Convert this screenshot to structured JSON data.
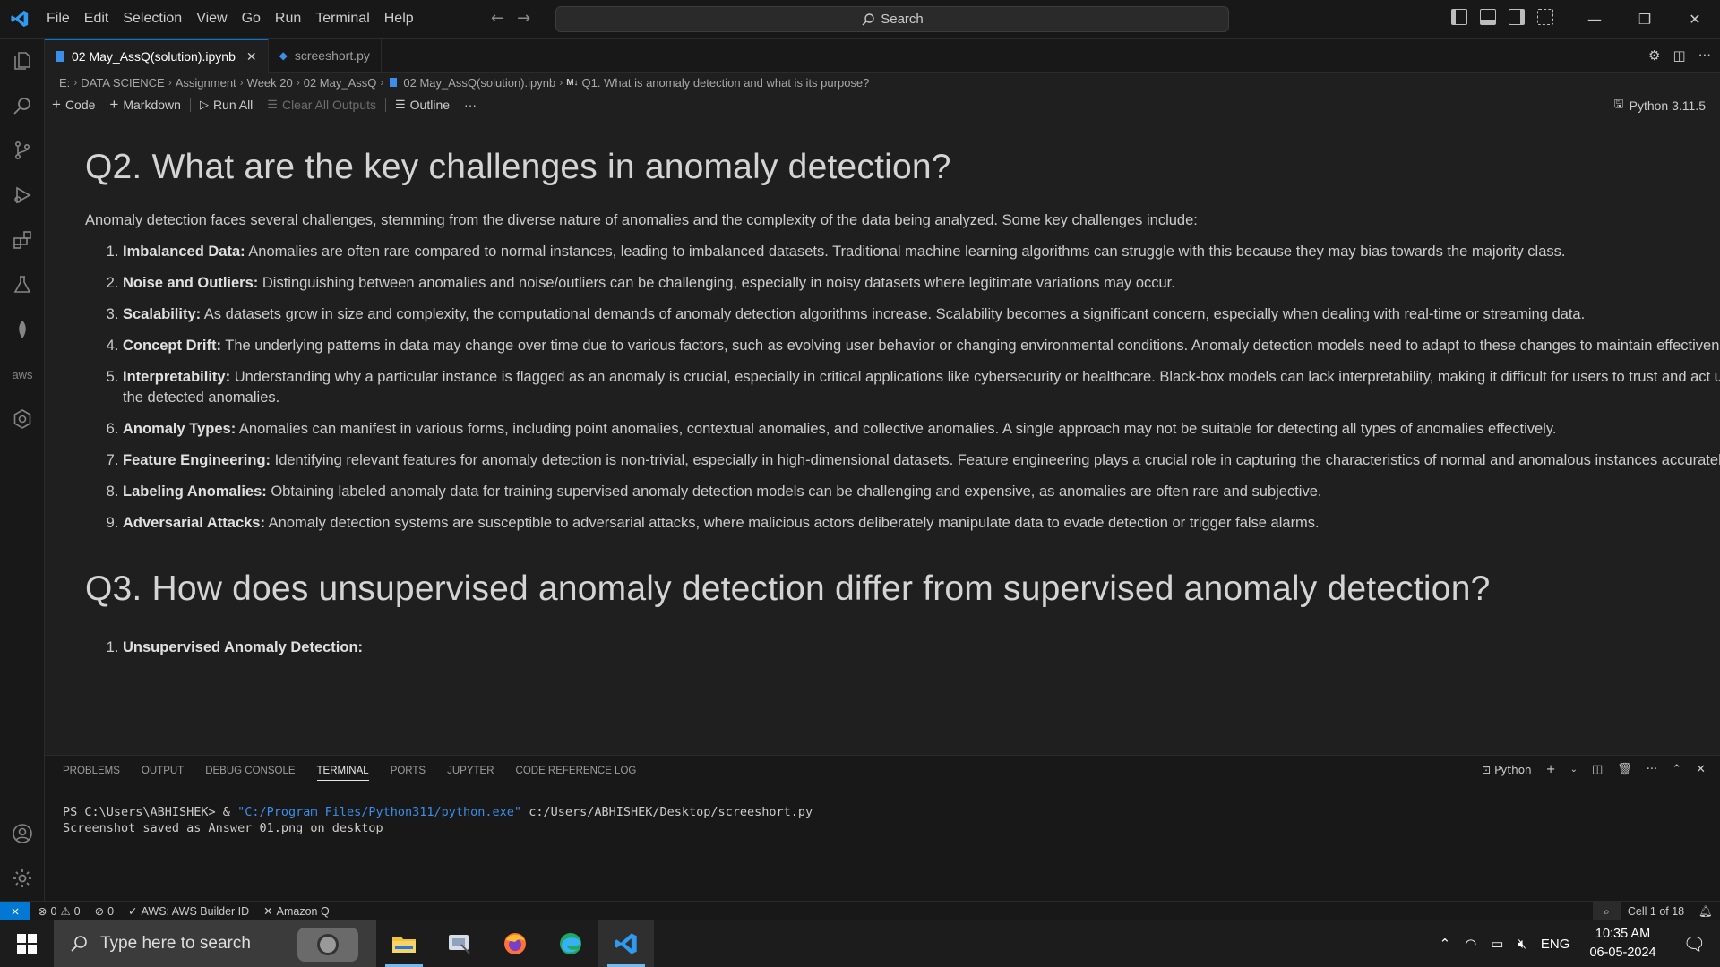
{
  "menu": [
    "File",
    "Edit",
    "Selection",
    "View",
    "Go",
    "Run",
    "Terminal",
    "Help"
  ],
  "search": {
    "label": "Search"
  },
  "tabs": [
    {
      "label": "02 May_AssQ(solution).ipynb",
      "active": true
    },
    {
      "label": "screeshort.py",
      "active": false
    }
  ],
  "breadcrumb": [
    "E:",
    "DATA SCIENCE",
    "Assignment",
    "Week 20",
    "02 May_AssQ",
    "02 May_AssQ(solution).ipynb",
    "Q1. What is anomaly detection and what is its purpose?"
  ],
  "breadcrumb_md_badge": "M↓",
  "notebook_toolbar": {
    "code": "Code",
    "markdown": "Markdown",
    "run_all": "Run All",
    "clear_outputs": "Clear All Outputs",
    "outline": "Outline",
    "more": "···",
    "kernel": "Python 3.11.5"
  },
  "notebook": {
    "q2_heading": "Q2. What are the key challenges in anomaly detection?",
    "q2_intro": "Anomaly detection faces several challenges, stemming from the diverse nature of anomalies and the complexity of the data being analyzed. Some key challenges include:",
    "challenges": [
      {
        "term": "Imbalanced Data:",
        "text": " Anomalies are often rare compared to normal instances, leading to imbalanced datasets. Traditional machine learning algorithms can struggle with this because they may bias towards the majority class."
      },
      {
        "term": "Noise and Outliers:",
        "text": " Distinguishing between anomalies and noise/outliers can be challenging, especially in noisy datasets where legitimate variations may occur."
      },
      {
        "term": "Scalability:",
        "text": " As datasets grow in size and complexity, the computational demands of anomaly detection algorithms increase. Scalability becomes a significant concern, especially when dealing with real-time or streaming data."
      },
      {
        "term": "Concept Drift:",
        "text": " The underlying patterns in data may change over time due to various factors, such as evolving user behavior or changing environmental conditions. Anomaly detection models need to adapt to these changes to maintain effectiveness."
      },
      {
        "term": "Interpretability:",
        "text": " Understanding why a particular instance is flagged as an anomaly is crucial, especially in critical applications like cybersecurity or healthcare. Black-box models can lack interpretability, making it difficult for users to trust and act upon the detected anomalies."
      },
      {
        "term": "Anomaly Types:",
        "text": " Anomalies can manifest in various forms, including point anomalies, contextual anomalies, and collective anomalies. A single approach may not be suitable for detecting all types of anomalies effectively."
      },
      {
        "term": "Feature Engineering:",
        "text": " Identifying relevant features for anomaly detection is non-trivial, especially in high-dimensional datasets. Feature engineering plays a crucial role in capturing the characteristics of normal and anomalous instances accurately."
      },
      {
        "term": "Labeling Anomalies:",
        "text": " Obtaining labeled anomaly data for training supervised anomaly detection models can be challenging and expensive, as anomalies are often rare and subjective."
      },
      {
        "term": "Adversarial Attacks:",
        "text": " Anomaly detection systems are susceptible to adversarial attacks, where malicious actors deliberately manipulate data to evade detection or trigger false alarms."
      }
    ],
    "q3_heading": "Q3. How does unsupervised anomaly detection differ from supervised anomaly detection?",
    "q3_item1": "Unsupervised Anomaly Detection:"
  },
  "panel": {
    "tabs": [
      "PROBLEMS",
      "OUTPUT",
      "DEBUG CONSOLE",
      "TERMINAL",
      "PORTS",
      "JUPYTER",
      "CODE REFERENCE LOG"
    ],
    "active_tab": "TERMINAL",
    "terminal_profile": "Python",
    "terminal_prompt": "PS C:\\Users\\ABHISHEK> & ",
    "terminal_exe": "\"C:/Program Files/Python311/python.exe\"",
    "terminal_script": " c:/Users/ABHISHEK/Desktop/screeshort.py",
    "terminal_output": "Screenshot saved as Answer 01.png on desktop"
  },
  "statusbar": {
    "errors": "0",
    "warnings": "0",
    "ports": "0",
    "aws": "AWS: AWS Builder ID",
    "amazon_q": "Amazon Q",
    "cell": "Cell 1 of 18"
  },
  "taskbar": {
    "search_placeholder": "Type here to search",
    "language": "ENG",
    "time": "10:35 AM",
    "date": "06-05-2024"
  },
  "colors": {
    "accent": "#0078d4",
    "link_string": "#3b8eea",
    "taskbar_active": "#76b9ed"
  }
}
